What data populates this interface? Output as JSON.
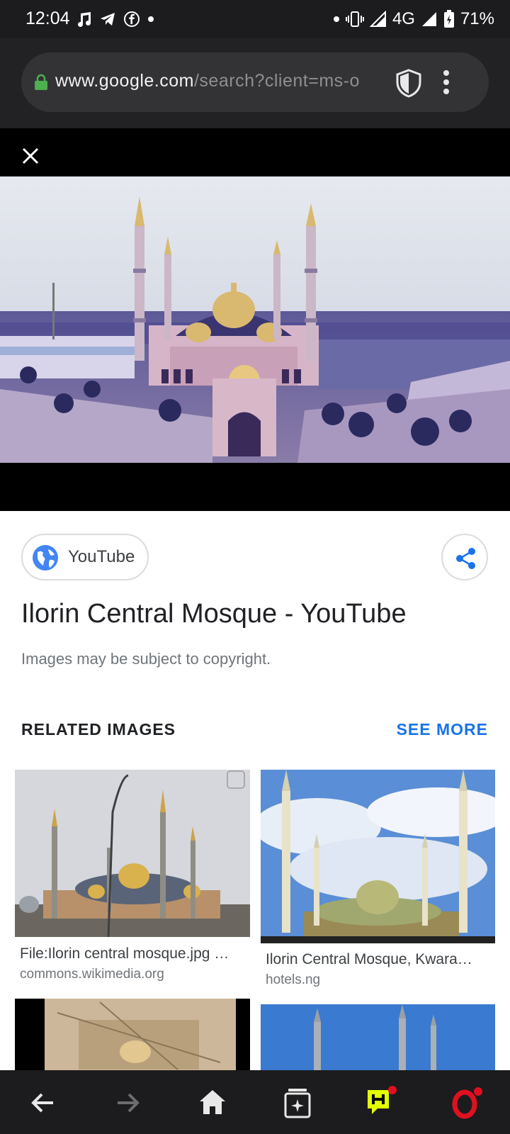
{
  "status_bar": {
    "time": "12:04",
    "network": "4G",
    "battery": "71%",
    "left_icons": [
      "music-note-icon",
      "telegram-icon",
      "facebook-icon",
      "dot-icon"
    ],
    "right_icons": [
      "dot-icon",
      "vibrate-icon",
      "signal-icon",
      "data-arrows-icon",
      "battery-icon"
    ]
  },
  "browser": {
    "url_domain": "www.google.com",
    "url_path": "/search?client=ms-o"
  },
  "result": {
    "source_label": "YouTube",
    "title": "Ilorin Central Mosque - YouTube",
    "copyright_note": "Images may be subject to copyright."
  },
  "related": {
    "heading": "RELATED IMAGES",
    "see_more": "SEE MORE",
    "items": [
      {
        "title": "File:Ilorin central mosque.jpg …",
        "source": "commons.wikimedia.org"
      },
      {
        "title": "Ilorin Central Mosque, Kwara…",
        "source": "hotels.ng"
      }
    ]
  },
  "colors": {
    "accent": "#1a73e8",
    "dark_bar": "#1c1c1e",
    "nav_highlight": "#e1ff00",
    "opera_red": "#e01020"
  }
}
